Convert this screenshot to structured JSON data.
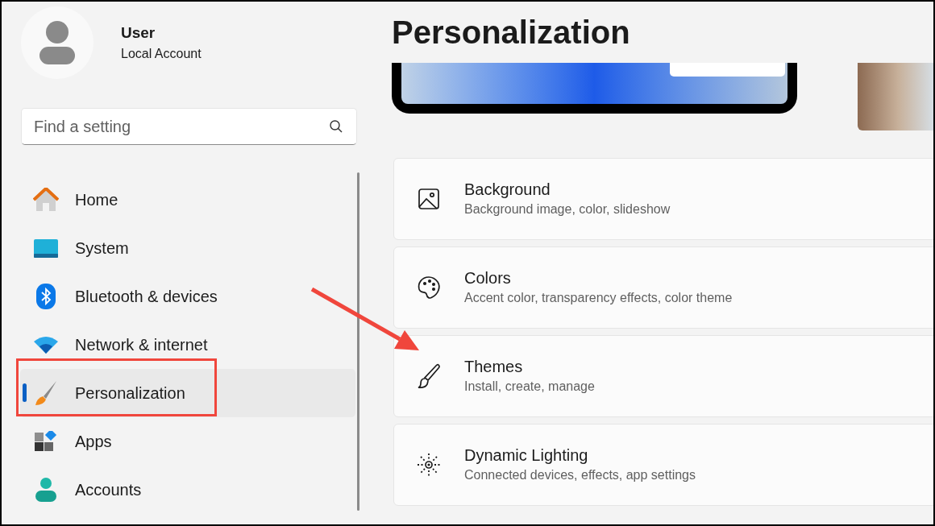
{
  "account": {
    "name": "User",
    "type": "Local Account"
  },
  "search": {
    "placeholder": "Find a setting"
  },
  "nav": [
    {
      "kind": "home",
      "label": "Home",
      "selected": false
    },
    {
      "kind": "system",
      "label": "System",
      "selected": false
    },
    {
      "kind": "bluetooth",
      "label": "Bluetooth & devices",
      "selected": false
    },
    {
      "kind": "network",
      "label": "Network & internet",
      "selected": false
    },
    {
      "kind": "personalization",
      "label": "Personalization",
      "selected": true
    },
    {
      "kind": "apps",
      "label": "Apps",
      "selected": false
    },
    {
      "kind": "accounts",
      "label": "Accounts",
      "selected": false
    }
  ],
  "page_title": "Personalization",
  "cards": [
    {
      "kind": "background",
      "title": "Background",
      "subtitle": "Background image, color, slideshow"
    },
    {
      "kind": "colors",
      "title": "Colors",
      "subtitle": "Accent color, transparency effects, color theme"
    },
    {
      "kind": "themes",
      "title": "Themes",
      "subtitle": "Install, create, manage"
    },
    {
      "kind": "lighting",
      "title": "Dynamic Lighting",
      "subtitle": "Connected devices, effects, app settings"
    }
  ]
}
